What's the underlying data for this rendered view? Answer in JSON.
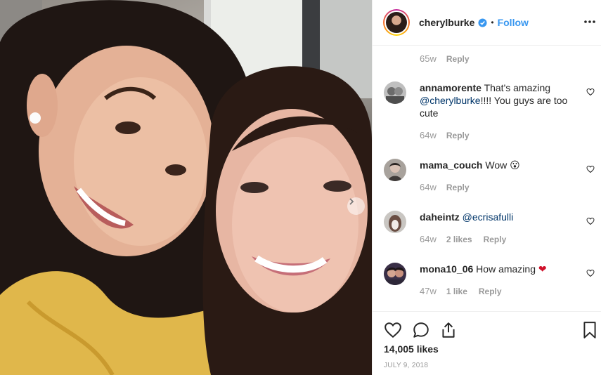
{
  "post": {
    "username": "cherylburke",
    "dot": "•",
    "follow_label": "Follow",
    "likes_text": "14,005 likes",
    "date": "JULY 9, 2018"
  },
  "first_meta": {
    "time": "65w",
    "reply": "Reply"
  },
  "comments": [
    {
      "user": "annamorente",
      "text_before": "That's amazing ",
      "mention": "@cherylburke",
      "text_after": "!!!! You guys are too cute",
      "time": "64w",
      "likes": "",
      "reply": "Reply"
    },
    {
      "user": "mama_couch",
      "text_before": "Wow ",
      "mention": "",
      "text_after": "",
      "emoji": "😮",
      "time": "64w",
      "likes": "",
      "reply": "Reply"
    },
    {
      "user": "daheintz",
      "text_before": "",
      "mention": "@ecrisafulli",
      "text_after": "",
      "time": "64w",
      "likes": "2 likes",
      "reply": "Reply"
    },
    {
      "user": "mona10_06",
      "text_before": "How amazing ",
      "mention": "",
      "text_after": "",
      "emoji": "❤",
      "time": "47w",
      "likes": "1 like",
      "reply": "Reply"
    }
  ],
  "icons": [
    "heart-icon",
    "comment-icon",
    "share-icon",
    "bookmark-icon",
    "verified-icon",
    "more-icon",
    "chevron-right-icon"
  ],
  "colors": {
    "accent": "#3897f0",
    "mention": "#003569",
    "muted": "#999999",
    "text": "#262626",
    "border": "#efefef"
  }
}
